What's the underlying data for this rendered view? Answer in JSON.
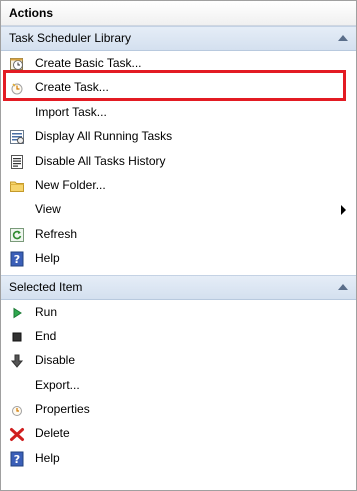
{
  "panel": {
    "title": "Actions"
  },
  "sections": {
    "library": {
      "header": "Task Scheduler Library",
      "items": [
        {
          "label": "Create Basic Task...",
          "icon": "create-basic-task-icon"
        },
        {
          "label": "Create Task...",
          "icon": "create-task-icon"
        },
        {
          "label": "Import Task...",
          "icon": ""
        },
        {
          "label": "Display All Running Tasks",
          "icon": "running-tasks-icon"
        },
        {
          "label": "Disable All Tasks History",
          "icon": "task-history-icon"
        },
        {
          "label": "New Folder...",
          "icon": "folder-icon"
        },
        {
          "label": "View",
          "icon": ""
        },
        {
          "label": "Refresh",
          "icon": "refresh-icon"
        },
        {
          "label": "Help",
          "icon": "help-icon"
        }
      ]
    },
    "selected": {
      "header": "Selected Item",
      "items": [
        {
          "label": "Run",
          "icon": "run-icon"
        },
        {
          "label": "End",
          "icon": "end-icon"
        },
        {
          "label": "Disable",
          "icon": "disable-icon"
        },
        {
          "label": "Export...",
          "icon": ""
        },
        {
          "label": "Properties",
          "icon": "properties-icon"
        },
        {
          "label": "Delete",
          "icon": "delete-icon"
        },
        {
          "label": "Help",
          "icon": "help-icon"
        }
      ]
    }
  },
  "colors": {
    "highlight": "#e31b23",
    "section_header_bg": "#d8e3f1"
  }
}
